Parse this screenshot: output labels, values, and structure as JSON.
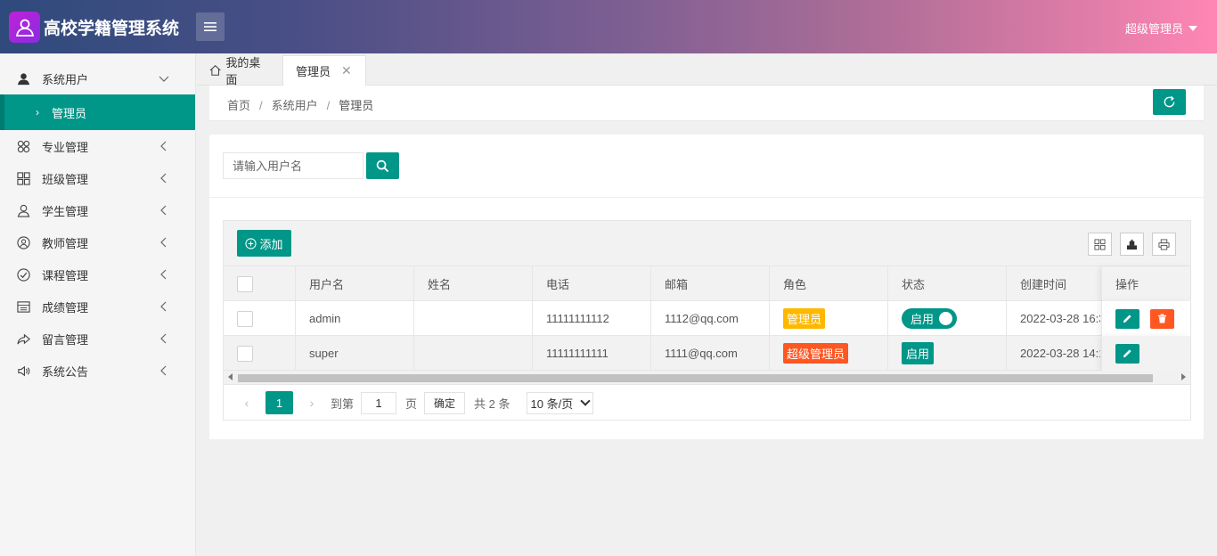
{
  "app": {
    "title": "高校学籍管理系统"
  },
  "header": {
    "user": "超级管理员"
  },
  "sidebar": {
    "items": [
      {
        "label": "系统用户",
        "icon": "user-icon",
        "expanded": true
      },
      {
        "label": "专业管理",
        "icon": "clover-icon"
      },
      {
        "label": "班级管理",
        "icon": "grid-icon"
      },
      {
        "label": "学生管理",
        "icon": "person-icon"
      },
      {
        "label": "教师管理",
        "icon": "face-icon"
      },
      {
        "label": "课程管理",
        "icon": "check-circle-icon"
      },
      {
        "label": "成绩管理",
        "icon": "table-icon"
      },
      {
        "label": "留言管理",
        "icon": "share-icon"
      },
      {
        "label": "系统公告",
        "icon": "speaker-icon"
      }
    ],
    "sub_active": "管理员"
  },
  "tabs": {
    "home": "我的桌面",
    "active": "管理员",
    "close": "✕"
  },
  "breadcrumb": {
    "home": "首页",
    "section": "系统用户",
    "current": "管理员",
    "sep": "/"
  },
  "search": {
    "placeholder": "请输入用户名",
    "value": ""
  },
  "toolbar": {
    "add_label": "添加"
  },
  "table": {
    "columns": [
      "用户名",
      "姓名",
      "电话",
      "邮箱",
      "角色",
      "状态",
      "创建时间",
      "操作"
    ],
    "rows": [
      {
        "username": "admin",
        "name": "",
        "phone": "11111111112",
        "email": "1112@qq.com",
        "role": "管理员",
        "status": "启用",
        "created": "2022-03-28 16:3..."
      },
      {
        "username": "super",
        "name": "",
        "phone": "11111111111",
        "email": "1111@qq.com",
        "role": "超级管理员",
        "status": "启用",
        "created": "2022-03-28 14:1..."
      }
    ]
  },
  "pager": {
    "prev": "‹",
    "next": "›",
    "current": "1",
    "goto_label": "到第",
    "page_input": "1",
    "page_suffix": "页",
    "confirm": "确定",
    "total": "共 2 条",
    "page_size": "10 条/页"
  },
  "colors": {
    "accent": "#009688",
    "warn": "#ffb800",
    "danger": "#ff5722"
  }
}
